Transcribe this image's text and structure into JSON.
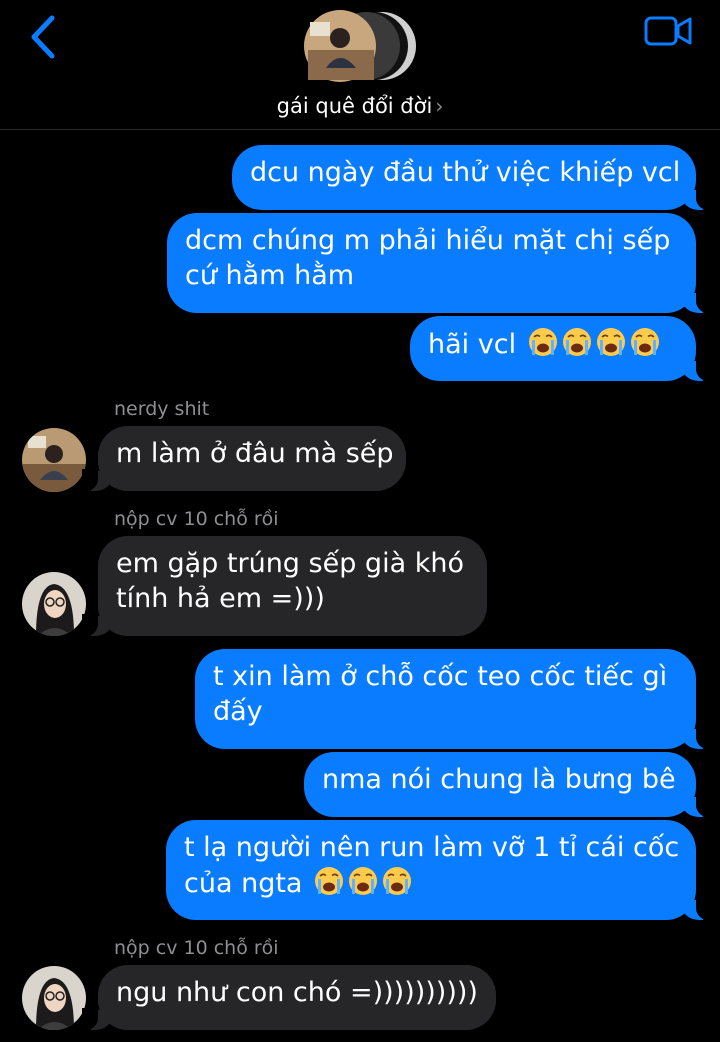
{
  "header": {
    "group_name": "gái quê đổi đời",
    "back_icon": "chevron-left-icon",
    "video_icon": "video-camera-icon",
    "accent": "#0a7cff"
  },
  "messages": [
    {
      "side": "out",
      "text": "dcu ngày đầu thử việc khiếp vcl"
    },
    {
      "side": "out",
      "line1": "dcm chúng m phải hiểu mặt chị sếp",
      "line2": "cứ hằm hằm"
    },
    {
      "side": "out",
      "text": "hãi vcl",
      "emoji": "loudly-crying-face x4"
    },
    {
      "side": "in",
      "sender": "nerdy shit",
      "text": "m làm ở đâu mà sếp"
    },
    {
      "side": "in",
      "sender": "nộp cv 10 chỗ rồi",
      "line1": "em gặp trúng sếp già khó",
      "line2": "tính hả em =)))"
    },
    {
      "side": "out",
      "line1": "t xin làm ở chỗ cốc teo cốc tiếc gì",
      "line2": "đấy"
    },
    {
      "side": "out",
      "text": "nma nói chung là bưng bê"
    },
    {
      "side": "out",
      "line1": "t lạ người nên run làm vỡ 1 tỉ cái cốc",
      "line2": "của ngta",
      "emoji": "loudly-crying-face x3"
    },
    {
      "side": "in",
      "sender": "nộp cv 10 chỗ rồi",
      "text": "ngu như con chó =))))))))))"
    }
  ],
  "colors": {
    "outgoing": "#0a7cff",
    "incoming": "#262628",
    "background": "#000000",
    "sender_label": "#8e8e93"
  }
}
